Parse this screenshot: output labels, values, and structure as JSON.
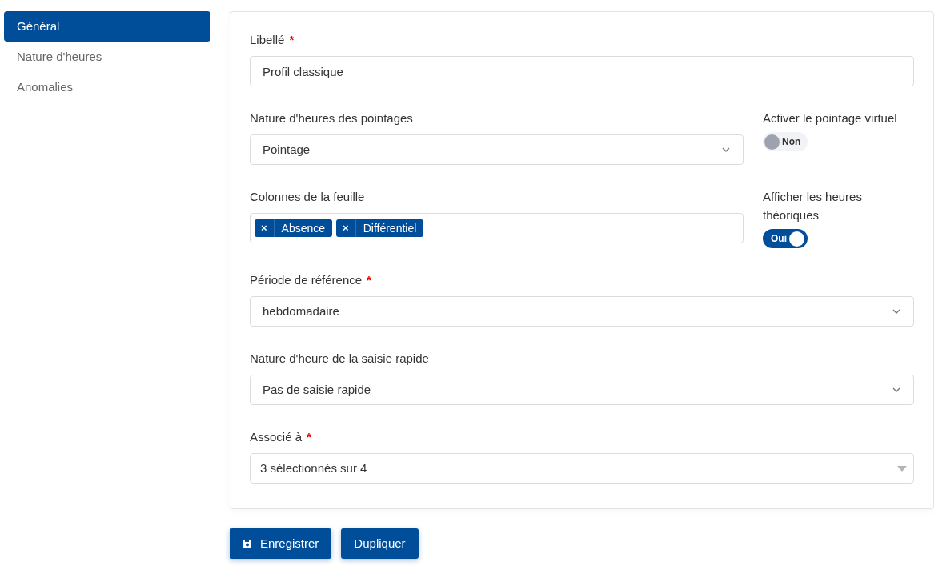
{
  "sidebar": {
    "items": [
      {
        "label": "Général",
        "selected": true
      },
      {
        "label": "Nature d'heures",
        "selected": false
      },
      {
        "label": "Anomalies",
        "selected": false
      }
    ]
  },
  "fields": [
    {
      "kind": "text",
      "label": "Libellé",
      "required_mark": "*",
      "value": "Profil classique"
    },
    {
      "kind": "select",
      "label": "Nature d'heures des pointages",
      "value": "Pointage",
      "toggle": {
        "label": "Activer le pointage virtuel",
        "on": false,
        "text": "Non"
      }
    },
    {
      "kind": "tags",
      "label": "Colonnes de la feuille",
      "tags": [
        {
          "remove": "×",
          "label": "Absence"
        },
        {
          "remove": "×",
          "label": "Différentiel"
        }
      ],
      "toggle": {
        "label": "Afficher les heures théoriques",
        "on": true,
        "text": "Oui"
      }
    },
    {
      "kind": "select",
      "label": "Période de référence",
      "required_mark": "*",
      "value": "hebdomadaire"
    },
    {
      "kind": "select",
      "label": "Nature d'heure de la saisie rapide",
      "value": "Pas de saisie rapide"
    },
    {
      "kind": "multiselect",
      "label": "Associé à",
      "required_mark": "*",
      "value": "3 sélectionnés sur 4"
    }
  ],
  "buttons": [
    {
      "kind": "save",
      "label": "Enregistrer"
    },
    {
      "kind": "plain",
      "label": "Dupliquer"
    }
  ]
}
